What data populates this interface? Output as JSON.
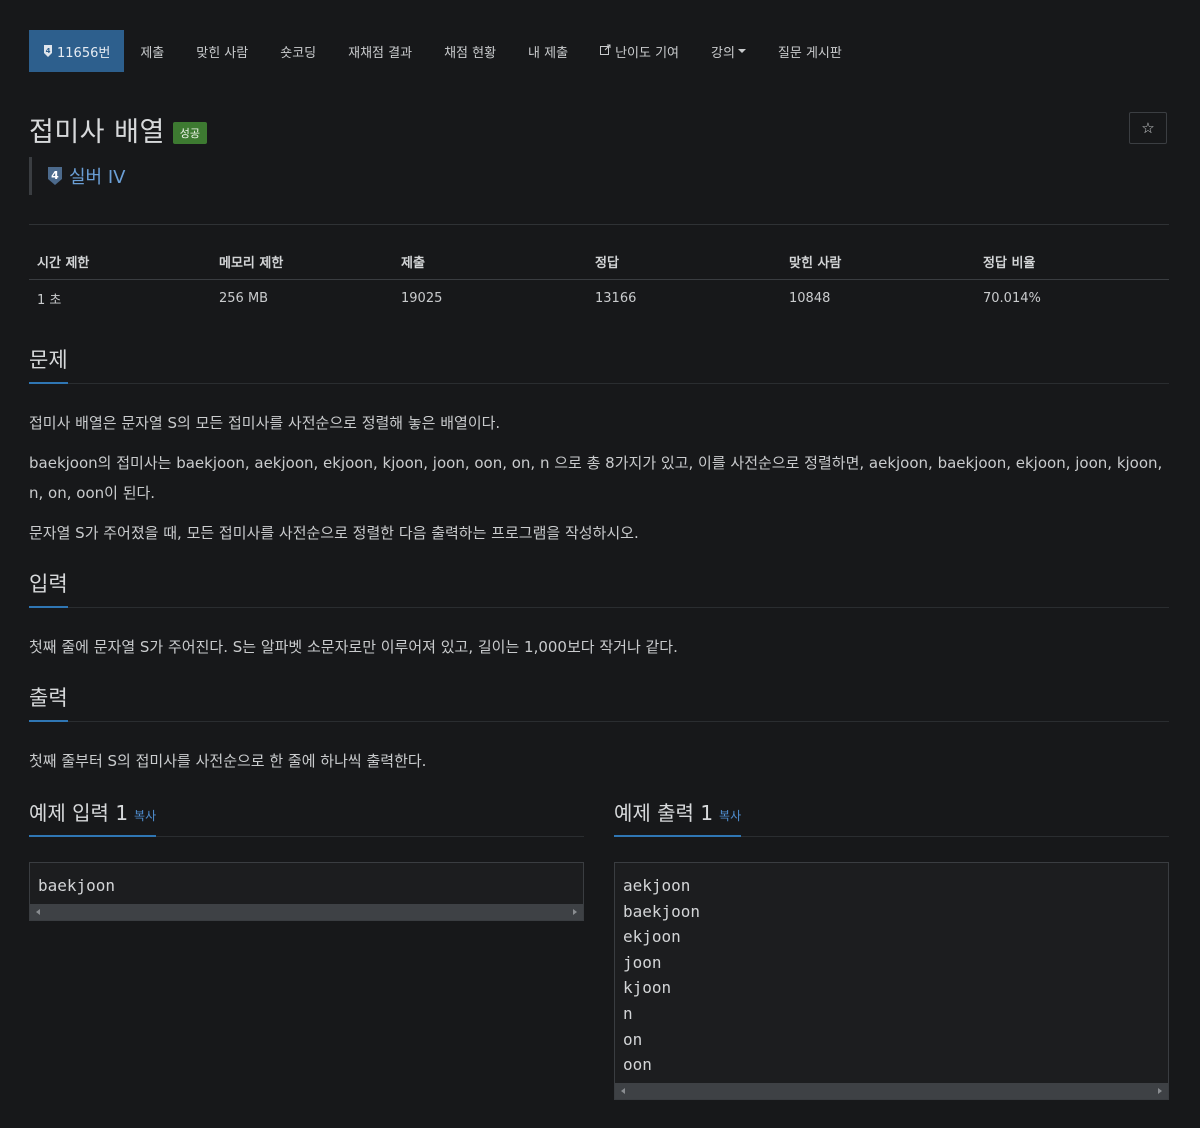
{
  "nav": {
    "problem_tab": "11656번",
    "items": [
      "제출",
      "맞힌 사람",
      "숏코딩",
      "재채점 결과",
      "채점 현황",
      "내 제출",
      "난이도 기여",
      "강의",
      "질문 게시판"
    ]
  },
  "problem": {
    "title": "접미사 배열",
    "status_badge": "성공",
    "tier_number": "4",
    "tier_label": "실버 IV",
    "tier_color": "#6b9fd6"
  },
  "stats": {
    "headers": [
      "시간 제한",
      "메모리 제한",
      "제출",
      "정답",
      "맞힌 사람",
      "정답 비율"
    ],
    "values": [
      "1 초",
      "256 MB",
      "19025",
      "13166",
      "10848",
      "70.014%"
    ]
  },
  "sections": {
    "description": {
      "title": "문제",
      "paragraphs": [
        "접미사 배열은 문자열 S의 모든 접미사를 사전순으로 정렬해 놓은 배열이다.",
        "baekjoon의 접미사는 baekjoon, aekjoon, ekjoon, kjoon, joon, oon, on, n 으로 총 8가지가 있고, 이를 사전순으로 정렬하면, aekjoon, baekjoon, ekjoon, joon, kjoon, n, on, oon이 된다.",
        "문자열 S가 주어졌을 때, 모든 접미사를 사전순으로 정렬한 다음 출력하는 프로그램을 작성하시오."
      ]
    },
    "input": {
      "title": "입력",
      "text": "첫째 줄에 문자열 S가 주어진다. S는 알파벳 소문자로만 이루어져 있고, 길이는 1,000보다 작거나 같다."
    },
    "output": {
      "title": "출력",
      "text": "첫째 줄부터 S의 접미사를 사전순으로 한 줄에 하나씩 출력한다."
    }
  },
  "samples": {
    "copy_label": "복사",
    "input": {
      "title": "예제 입력 1",
      "content": "baekjoon"
    },
    "output": {
      "title": "예제 출력 1",
      "content": "aekjoon\nbaekjoon\nekjoon\njoon\nkjoon\nn\non\noon"
    }
  },
  "colors": {
    "accent": "#2f76b4",
    "success": "#3d7a31",
    "nav_active": "#2d5f8d"
  },
  "icons": {
    "star": "star-icon",
    "external": "external-link-icon",
    "tier": "silver-tier-icon"
  }
}
